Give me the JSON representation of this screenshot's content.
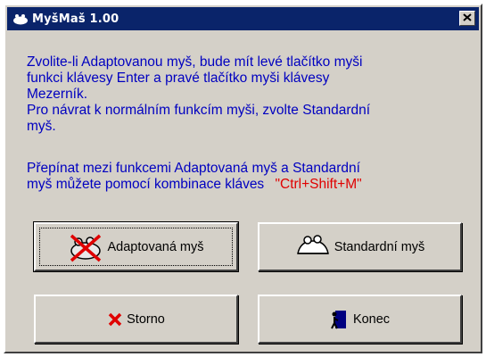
{
  "window": {
    "title": "MyšMaš 1.00"
  },
  "message": {
    "line1": "Zvolite-li Adaptovanou myš, bude mít levé tlačítko myši",
    "line2": "funkci klávesy Enter a pravé tlačítko myši klávesy",
    "line3": "Mezerník.",
    "line4": "Pro návrat k normálním funkcím myši, zvolte Standardní",
    "line5": "myš.",
    "line6": "Přepínat mezi funkcemi Adaptovaná myš a Standardní",
    "line7": "myš můžete pomocí kombinace kláves",
    "hotkey": "\"Ctrl+Shift+M\""
  },
  "buttons": {
    "adaptive": "Adaptovaná myš",
    "standard": "Standardní myš",
    "cancel": "Storno",
    "exit": "Konec"
  },
  "colors": {
    "titlebar": "#0a246a",
    "text": "#0000c0",
    "hotkey": "#e00000",
    "face": "#d4d0c8"
  },
  "icons": [
    "mouse-icon",
    "close-icon",
    "crossed-mouse-icon",
    "mouse-outline-icon",
    "red-x-icon",
    "door-exit-icon"
  ]
}
